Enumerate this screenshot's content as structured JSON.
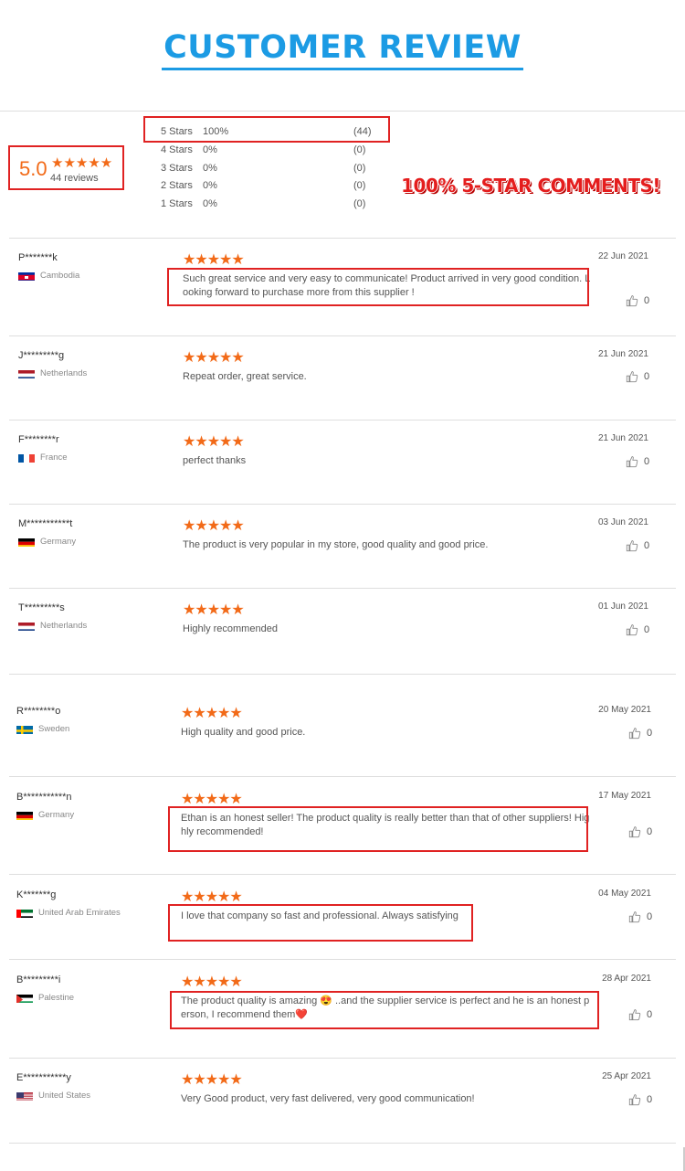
{
  "header": {
    "title": "CUSTOMER REVIEW"
  },
  "summary": {
    "score": "5.0",
    "stars": "★★★★★",
    "count_label": "44 reviews",
    "distribution": [
      {
        "label": "5  Stars",
        "percent": "100%",
        "count": "(44)"
      },
      {
        "label": "4  Stars",
        "percent": "0%",
        "count": "(0)"
      },
      {
        "label": "3  Stars",
        "percent": "0%",
        "count": "(0)"
      },
      {
        "label": "2  Stars",
        "percent": "0%",
        "count": "(0)"
      },
      {
        "label": "1  Stars",
        "percent": "0%",
        "count": "(0)"
      }
    ]
  },
  "banner": "100% 5-STAR COMMENTS!",
  "colors": {
    "accent": "#f26a18",
    "title_blue": "#1c9be4",
    "highlight_red": "#e02222"
  },
  "reviews": [
    {
      "name": "P*******k",
      "country": "Cambodia",
      "flag": "cambodia-flag",
      "stars": "★★★★★",
      "rating": 5,
      "date": "22 Jun 2021",
      "text": "Such great service and very easy to communicate! Product arrived in very good condition. L\nooking forward to purchase more from this supplier !",
      "likes": "0"
    },
    {
      "name": "J*********g",
      "country": "Netherlands",
      "flag": "netherlands-flag",
      "stars": "★★★★★",
      "rating": 5,
      "date": "21 Jun 2021",
      "text": "Repeat order, great service.",
      "likes": "0"
    },
    {
      "name": "F********r",
      "country": "France",
      "flag": "france-flag",
      "stars": "★★★★★",
      "rating": 5,
      "date": "21 Jun 2021",
      "text": "perfect thanks",
      "likes": "0"
    },
    {
      "name": "M***********t",
      "country": "Germany",
      "flag": "germany-flag",
      "stars": "★★★★★",
      "rating": 5,
      "date": "03 Jun 2021",
      "text": "The product is very popular in my store, good quality and good price.",
      "likes": "0"
    },
    {
      "name": "T*********s",
      "country": "Netherlands",
      "flag": "netherlands-flag",
      "stars": "★★★★★",
      "rating": 5,
      "date": "01 Jun 2021",
      "text": "Highly recommended",
      "likes": "0"
    },
    {
      "name": "R********o",
      "country": "Sweden",
      "flag": "sweden-flag",
      "stars": "★★★★★",
      "rating": 5,
      "date": "20 May 2021",
      "text": "High quality and good price.",
      "likes": "0"
    },
    {
      "name": "B***********n",
      "country": "Germany",
      "flag": "germany-flag",
      "stars": "★★★★★",
      "rating": 5,
      "date": "17 May 2021",
      "text": "Ethan is an honest seller! The product quality is really better than that of other suppliers! Hig\nhly recommended!",
      "likes": "0"
    },
    {
      "name": "K*******g",
      "country": "United Arab Emirates",
      "flag": "uae-flag",
      "stars": "★★★★★",
      "rating": 5,
      "date": "04 May 2021",
      "text": "I love that company so fast and professional. Always satisfying",
      "likes": "0"
    },
    {
      "name": "B*********i",
      "country": "Palestine",
      "flag": "palestine-flag",
      "stars": "★★★★★",
      "rating": 5,
      "date": "28 Apr 2021",
      "text": "The product quality is amazing 😍 ..and the supplier service is perfect and he is an honest p\nerson, I recommend them❤️",
      "likes": "0"
    },
    {
      "name": "E***********y",
      "country": "United States",
      "flag": "usa-flag",
      "stars": "★★★★★",
      "rating": 5,
      "date": "25 Apr 2021",
      "text": "Very Good product, very fast delivered, very good communication!",
      "likes": "0"
    }
  ]
}
